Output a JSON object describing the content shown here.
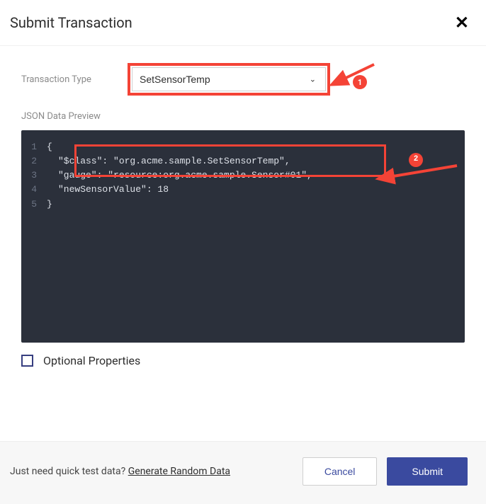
{
  "header": {
    "title": "Submit Transaction"
  },
  "form": {
    "type_label": "Transaction Type",
    "type_value": "SetSensorTemp",
    "preview_label": "JSON Data Preview",
    "optional_label": "Optional Properties"
  },
  "code": {
    "l1": "{",
    "l2": "\"$class\": \"org.acme.sample.SetSensorTemp\",",
    "l3": "\"gauge\": \"resource:org.acme.sample.Sensor#01\",",
    "l4": "\"newSensorValue\": 18",
    "l5": "}"
  },
  "gutter": {
    "n1": "1",
    "n2": "2",
    "n3": "3",
    "n4": "4",
    "n5": "5"
  },
  "footer": {
    "hint": "Just need quick test data? ",
    "link": "Generate Random Data",
    "cancel": "Cancel",
    "submit": "Submit"
  },
  "annot": {
    "badge1": "1",
    "badge2": "2"
  }
}
